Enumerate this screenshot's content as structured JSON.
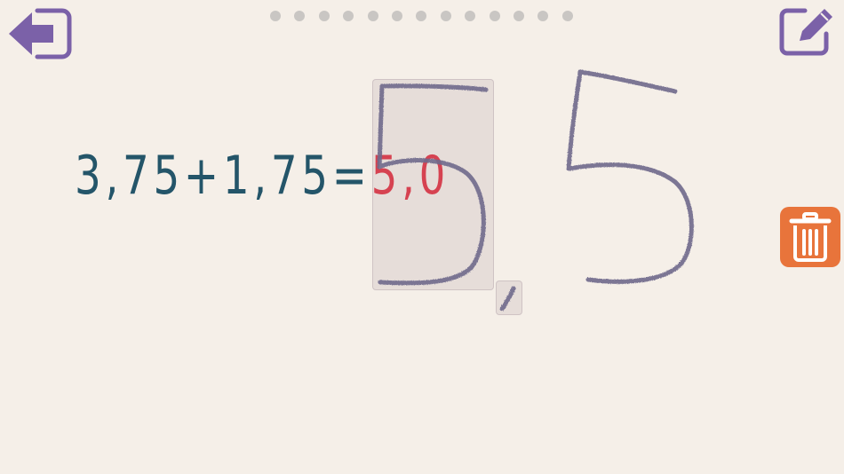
{
  "equation": {
    "expression": "3,75+1,75=",
    "answer": "5,0"
  },
  "progress": {
    "total_dots": 13
  },
  "icons": {
    "back": "back-arrow-icon",
    "edit": "pencil-edit-icon",
    "trash": "trash-icon"
  },
  "colors": {
    "background": "#f5efe8",
    "equation": "#245569",
    "answer": "#e0182b",
    "accent_purple": "#7b61a8",
    "trash_orange": "#e8743b",
    "ink": "#6f6a8c"
  },
  "handwriting": {
    "strokes_recognized": [
      "5",
      ",",
      "5"
    ]
  }
}
